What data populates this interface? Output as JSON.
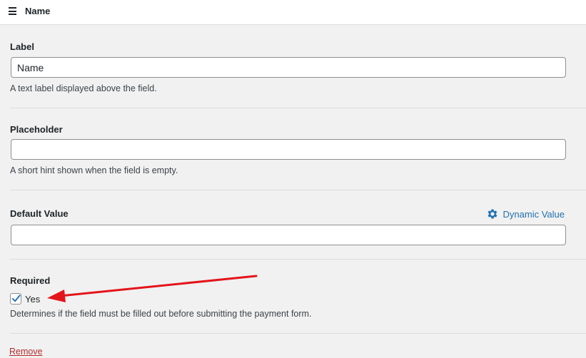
{
  "header": {
    "title": "Name",
    "menu_icon": "hamburger-icon"
  },
  "fields": {
    "label": {
      "title": "Label",
      "value": "Name",
      "help": "A text label displayed above the field."
    },
    "placeholder": {
      "title": "Placeholder",
      "value": "",
      "help": "A short hint shown when the field is empty."
    },
    "default_value": {
      "title": "Default Value",
      "value": "",
      "dynamic_label": "Dynamic Value",
      "dynamic_icon": "gear-icon"
    },
    "required": {
      "title": "Required",
      "checked": true,
      "option_label": "Yes",
      "help": "Determines if the field must be filled out before submitting the payment form."
    }
  },
  "remove_label": "Remove",
  "colors": {
    "link": "#2271b1",
    "danger": "#b32d2e",
    "annotation_arrow": "#e3151a",
    "background": "#f1f1f1"
  }
}
